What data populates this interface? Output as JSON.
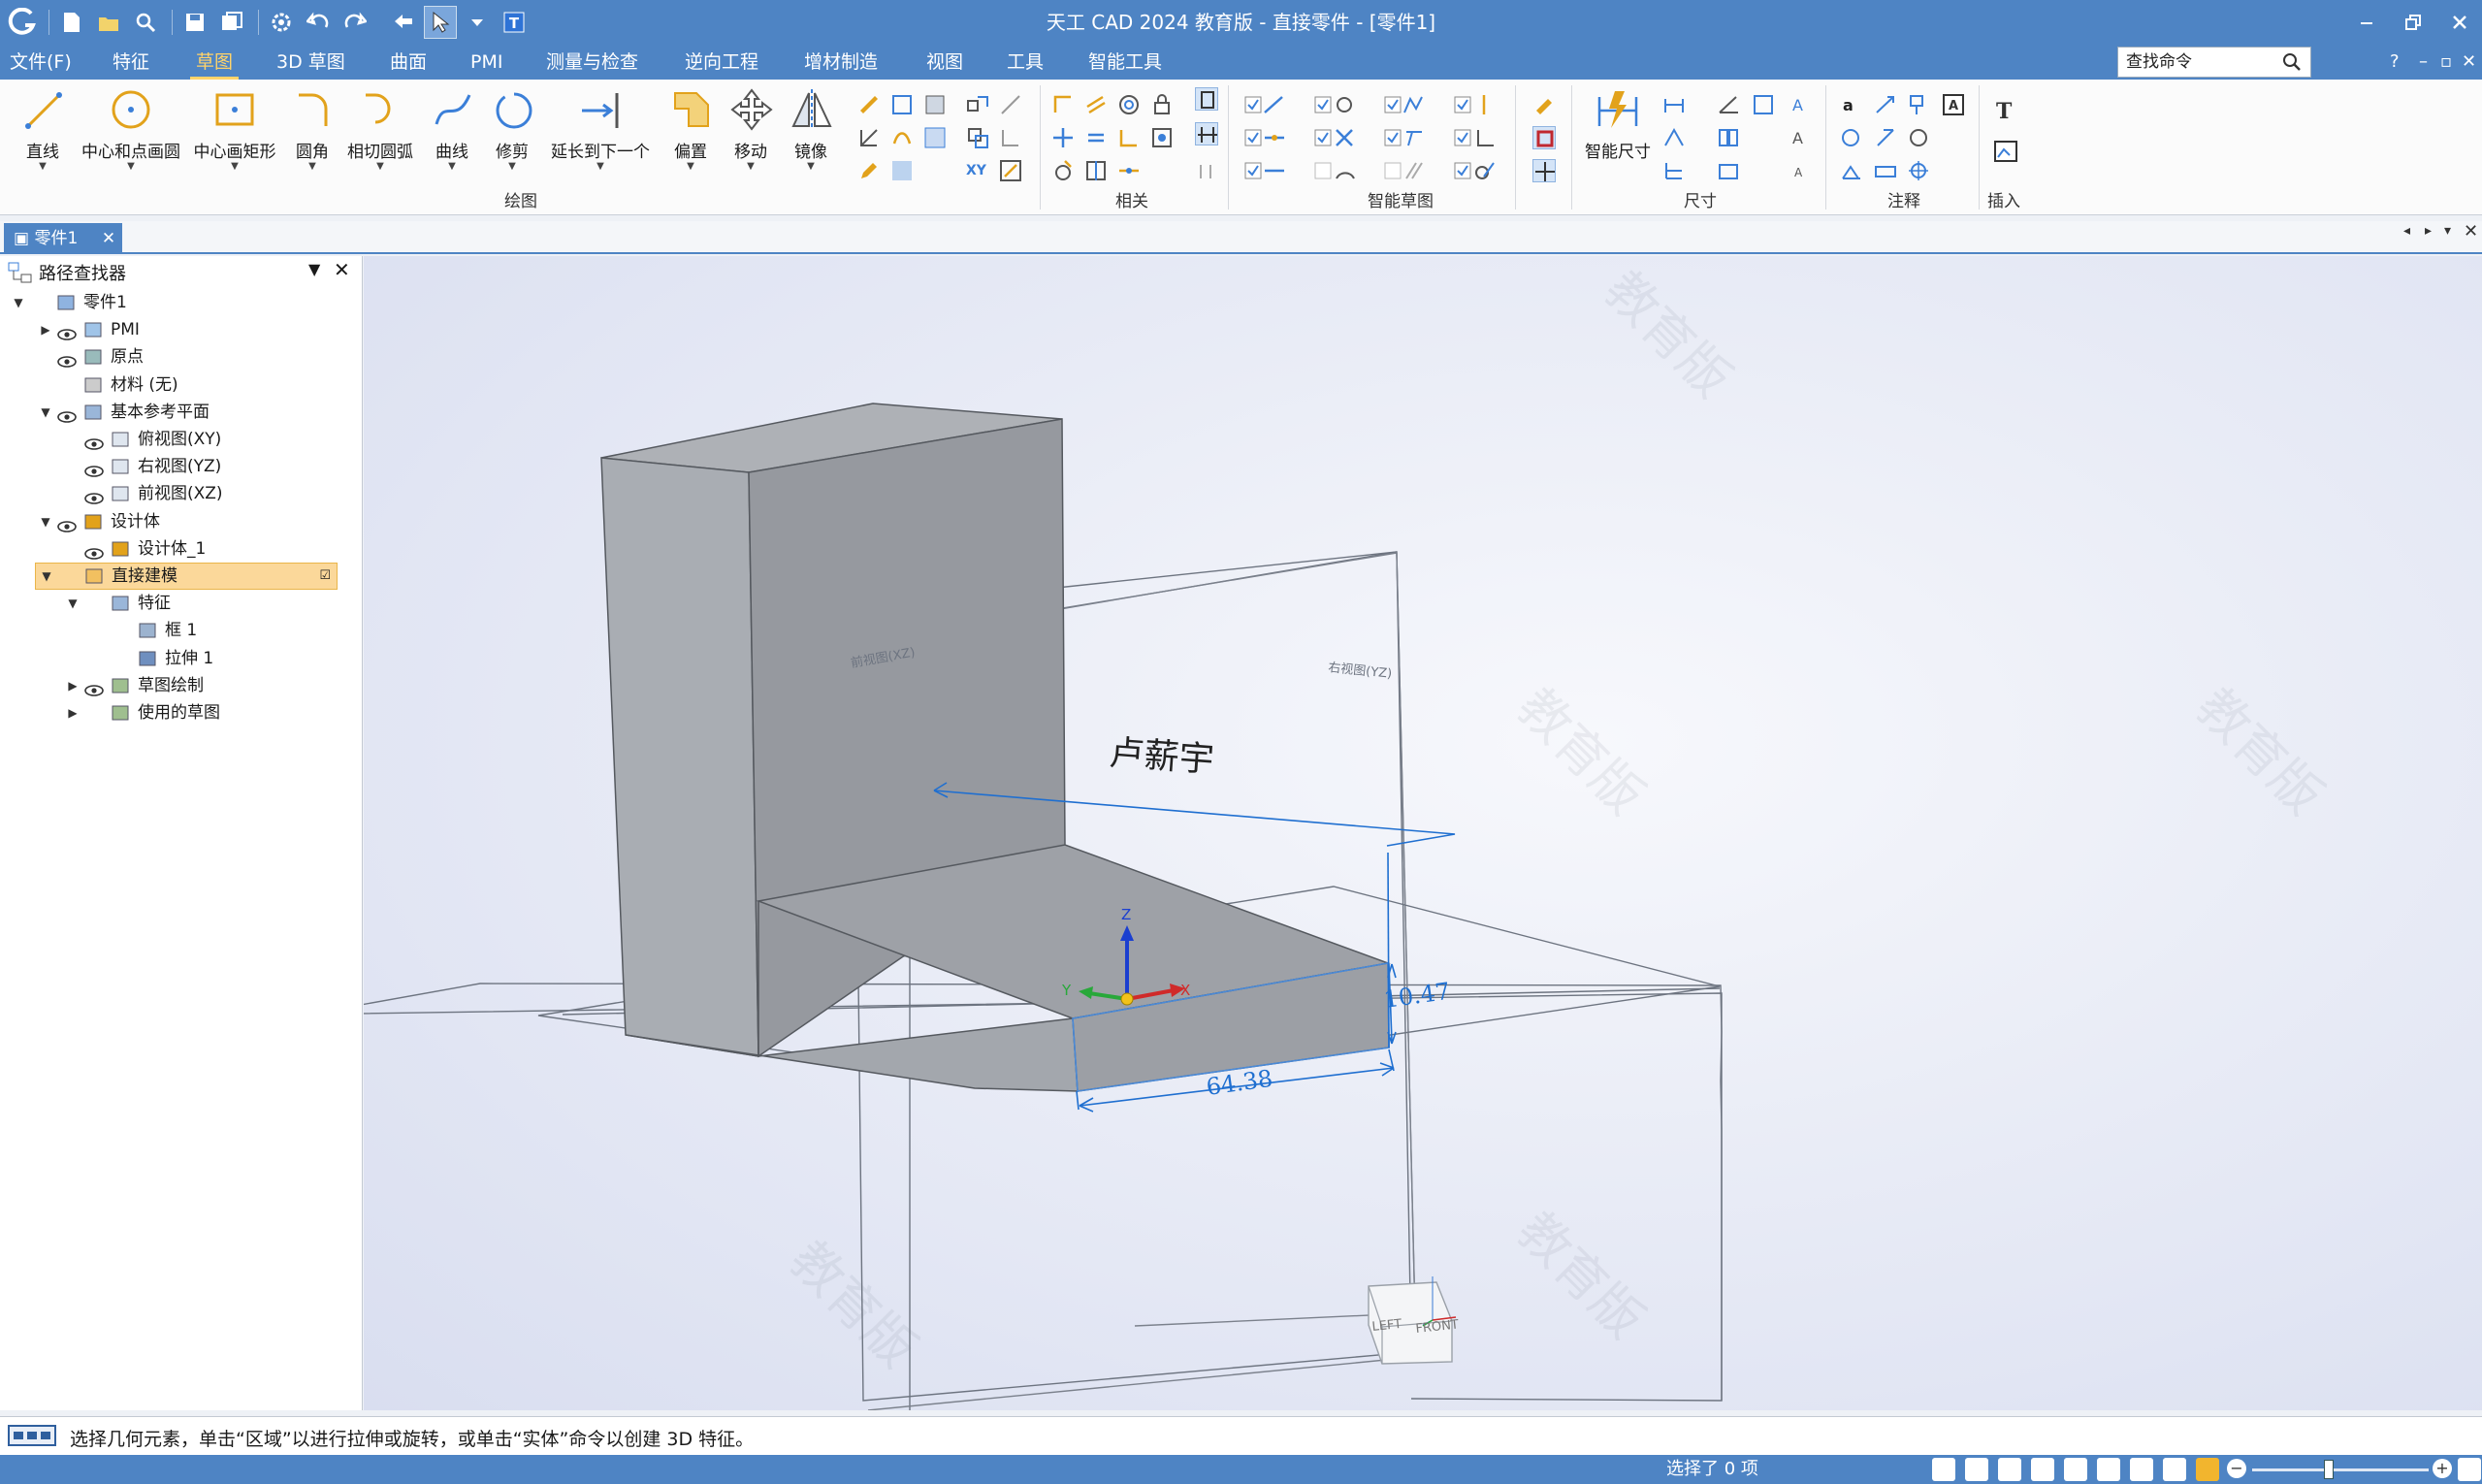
{
  "app": {
    "title": "天工 CAD 2024 教育版 - 直接零件 - [零件1]"
  },
  "menu": {
    "items": [
      "文件(F)",
      "特征",
      "草图",
      "3D 草图",
      "曲面",
      "PMI",
      "测量与检查",
      "逆向工程",
      "增材制造",
      "视图",
      "工具",
      "智能工具"
    ],
    "active_index": 2,
    "search_placeholder": "查找命令",
    "help": "?"
  },
  "ribbon": {
    "buttons": {
      "line": "直线",
      "center_circle": "中心和点画圆",
      "center_rect": "中心画矩形",
      "fillet": "圆角",
      "tangent_arc": "相切圆弧",
      "curve": "曲线",
      "trim": "修剪",
      "extend": "延长到下一个",
      "offset": "偏置",
      "move": "移动",
      "mirror": "镜像",
      "smart_dim": "智能尺寸"
    },
    "groups": {
      "draw": "绘图",
      "relate": "相关",
      "intellisketch": "智能草图",
      "dimension": "尺寸",
      "annotation": "注释",
      "insert": "插入"
    },
    "xy_label": "XY"
  },
  "doc_tab": {
    "label": "零件1"
  },
  "pathfinder": {
    "title": "路径查找器",
    "tree": [
      {
        "label": "零件1",
        "level": 0,
        "twisty": "open",
        "eye": false
      },
      {
        "label": "PMI",
        "level": 1,
        "twisty": "closed",
        "eye": true
      },
      {
        "label": "原点",
        "level": 1,
        "twisty": "none",
        "eye": true
      },
      {
        "label": "材料 (无)",
        "level": 1,
        "twisty": "none",
        "eye": false
      },
      {
        "label": "基本参考平面",
        "level": 1,
        "twisty": "open",
        "eye": true
      },
      {
        "label": "俯视图(XY)",
        "level": 2,
        "twisty": "none",
        "eye": true
      },
      {
        "label": "右视图(YZ)",
        "level": 2,
        "twisty": "none",
        "eye": true
      },
      {
        "label": "前视图(XZ)",
        "level": 2,
        "twisty": "none",
        "eye": true
      },
      {
        "label": "设计体",
        "level": 1,
        "twisty": "open",
        "eye": true
      },
      {
        "label": "设计体_1",
        "level": 2,
        "twisty": "none",
        "eye": true
      },
      {
        "label": "直接建模",
        "level": 1,
        "twisty": "open",
        "eye": false,
        "selected": true
      },
      {
        "label": "特征",
        "level": 2,
        "twisty": "open",
        "eye": false
      },
      {
        "label": "框 1",
        "level": 3,
        "twisty": "none",
        "eye": false
      },
      {
        "label": "拉伸 1",
        "level": 3,
        "twisty": "none",
        "eye": false
      },
      {
        "label": "草图绘制",
        "level": 2,
        "twisty": "closed",
        "eye": true
      },
      {
        "label": "使用的草图",
        "level": 2,
        "twisty": "closed",
        "eye": false
      }
    ]
  },
  "viewport": {
    "annotation_text": "卢薪宇",
    "dim_height": "10.47",
    "dim_width": "64.38",
    "plane_front_label": "前视图(XZ)",
    "plane_right_label": "右视图(YZ)",
    "axis_z": "Z",
    "axis_x": "X",
    "axis_y": "Y",
    "viewcube_left": "LEFT",
    "viewcube_front": "FRONT",
    "watermark": "教育版"
  },
  "status": {
    "message": "选择几何元素，单击“区域”以进行拉伸或旋转，或单击“实体”命令以创建 3D 特征。",
    "selection": "选择了 0 项"
  },
  "colors": {
    "accent": "#4e84c4",
    "highlight": "#ffd36a",
    "dimension": "#1f6fd0"
  }
}
